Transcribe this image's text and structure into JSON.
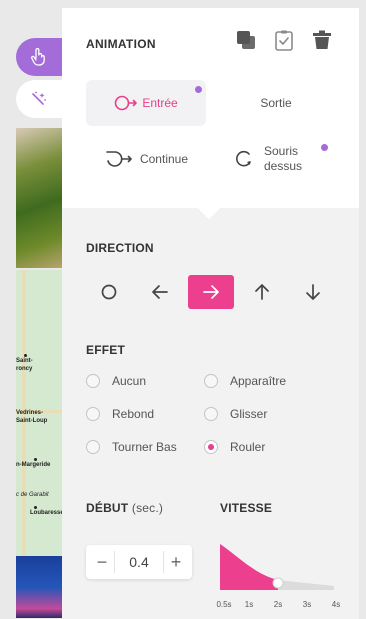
{
  "panel": {
    "title": "ANIMATION",
    "toolbar_icons": [
      "duplicate-icon",
      "clipboard-check-icon",
      "trash-icon"
    ]
  },
  "animation_types": [
    {
      "label": "Entrée",
      "active": true,
      "has_dot": true,
      "icon": "circle-arrow-icon"
    },
    {
      "label": "Sortie",
      "active": false,
      "has_dot": false,
      "icon": ""
    },
    {
      "label": "Continue",
      "active": false,
      "has_dot": false,
      "icon": "loop-arrow-icon"
    },
    {
      "label": "Souris dessus",
      "active": false,
      "has_dot": true,
      "icon": "hover-circle-icon"
    }
  ],
  "direction": {
    "label": "DIRECTION",
    "options": [
      "circle-icon",
      "arrow-left-icon",
      "arrow-right-icon",
      "arrow-up-icon",
      "arrow-down-icon"
    ],
    "selected": "arrow-right-icon"
  },
  "effect": {
    "label": "EFFET",
    "options": [
      "Aucun",
      "Apparaître",
      "Rebond",
      "Glisser",
      "Tourner Bas",
      "Rouler"
    ],
    "selected": "Rouler"
  },
  "start": {
    "label": "DÉBUT",
    "unit": "(sec.)",
    "value": "0.4",
    "minus": "−",
    "plus": "+"
  },
  "speed": {
    "label": "VITESSE",
    "ticks": [
      "0.5s",
      "1s",
      "2s",
      "3s",
      "4s"
    ],
    "value": "2s"
  },
  "background_map_labels": [
    "Saint-",
    "roncy",
    "Vedrines-",
    "Saint-Loup",
    "n-Margeride",
    "c de Garabit",
    "Loubaresse"
  ],
  "colors": {
    "accent": "#ec3f8d",
    "purple": "#a36cd8",
    "panel_bg": "#f2f2f3"
  }
}
